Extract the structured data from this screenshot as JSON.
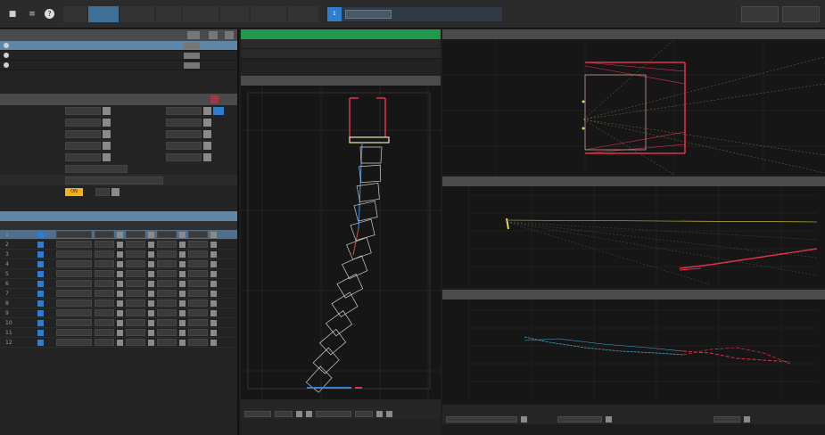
{
  "topbar": {
    "icons": [
      "speaker-icon",
      "list-icon",
      "info-icon"
    ],
    "tabs": [
      "",
      "",
      "",
      "",
      "",
      "",
      "",
      ""
    ],
    "active_tab_index": 1,
    "info_number": "1",
    "info_text": "",
    "right_boxes": [
      "",
      ""
    ]
  },
  "sources": {
    "title": "",
    "rows": [
      {
        "label": "",
        "m1": "",
        "m2": "",
        "selected": true
      },
      {
        "label": "",
        "m1": "",
        "m2": "",
        "selected": false
      },
      {
        "label": "",
        "m1": "",
        "m2": "",
        "selected": false
      }
    ]
  },
  "array": {
    "title": "",
    "fields": [
      {
        "l1": "",
        "v1": "",
        "l2": "",
        "v2": ""
      },
      {
        "l1": "",
        "v1": "",
        "l2": "",
        "v2": ""
      },
      {
        "l1": "",
        "v1": "",
        "l2": "",
        "v2": ""
      },
      {
        "l1": "",
        "v1": "",
        "l2": "",
        "v2": ""
      },
      {
        "l1": "",
        "v1": "",
        "l2": "",
        "v2": ""
      }
    ],
    "extra_rows": [
      "",
      "",
      "",
      ""
    ],
    "toggle_label": "",
    "toggle_value": "ON",
    "cabinets_label": "",
    "blue_label": "",
    "table_headers": [
      "",
      "",
      "",
      "",
      "",
      "",
      "",
      "",
      ""
    ],
    "rows": [
      "1",
      "2",
      "3",
      "4",
      "5",
      "6",
      "7",
      "8",
      "9",
      "10",
      "11",
      "12"
    ]
  },
  "mid": {
    "green_left": "",
    "green_mid": "",
    "green_right": "",
    "info_rows": [
      {
        "a": "",
        "b": ""
      },
      {
        "a": "",
        "b": ""
      }
    ],
    "plot_title": "",
    "bottom_labels": [
      "",
      ""
    ]
  },
  "right": {
    "top_title": "",
    "mid_title": "",
    "bottom_title": "",
    "bottom_label": ""
  },
  "colors": {
    "accent": "#2f7dd1",
    "selected_row": "#5d87a8",
    "green": "#1f9a4a",
    "red_line": "#e0304a",
    "yellow_line": "#e6d84a",
    "cyan_line": "#3fa7c9",
    "orange_button": "#f2b21b"
  }
}
